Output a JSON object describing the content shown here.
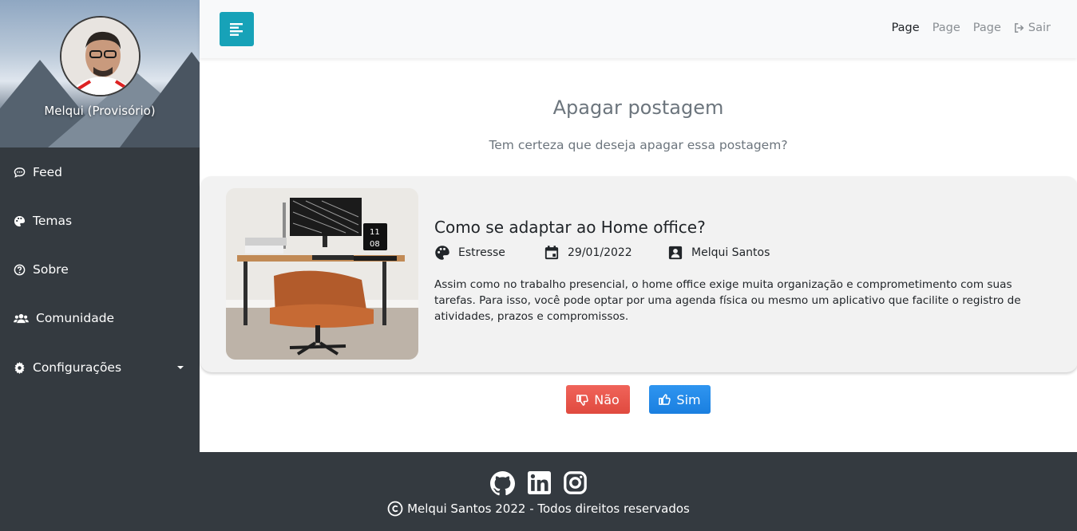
{
  "sidebar": {
    "profile_name": "Melqui (Provisório)",
    "items": [
      {
        "label": "Feed",
        "icon": "comment-icon"
      },
      {
        "label": "Temas",
        "icon": "palette-icon"
      },
      {
        "label": "Sobre",
        "icon": "question-circle-icon"
      },
      {
        "label": "Comunidade",
        "icon": "users-icon"
      },
      {
        "label": "Configurações",
        "icon": "gear-icon"
      }
    ]
  },
  "topbar": {
    "nav": [
      "Page",
      "Page",
      "Page"
    ],
    "logout_label": "Sair"
  },
  "main": {
    "title": "Apagar postagem",
    "subtitle": "Tem certeza que deseja apagar essa postagem?"
  },
  "post": {
    "title": "Como se adaptar ao Home office?",
    "theme": "Estresse",
    "date": "29/01/2022",
    "author": "Melqui Santos",
    "text": "Assim como no trabalho presencial, o home office exige muita organização e comprometimento com suas tarefas. Para isso, você pode optar por uma agenda física ou mesmo um aplicativo que facilite o registro de atividades, prazos e compromissos.",
    "image_clock": [
      "11",
      "08"
    ]
  },
  "actions": {
    "no_label": "Não",
    "yes_label": "Sim"
  },
  "footer": {
    "copyright": "Melqui Santos 2022 - Todos direitos reservados",
    "social": [
      "github-icon",
      "linkedin-icon",
      "instagram-icon"
    ]
  },
  "colors": {
    "sidebar_bg": "#343a40",
    "toggle_btn": "#17a2b8",
    "btn_no": "#e9574c",
    "btn_yes": "#2389e8"
  }
}
